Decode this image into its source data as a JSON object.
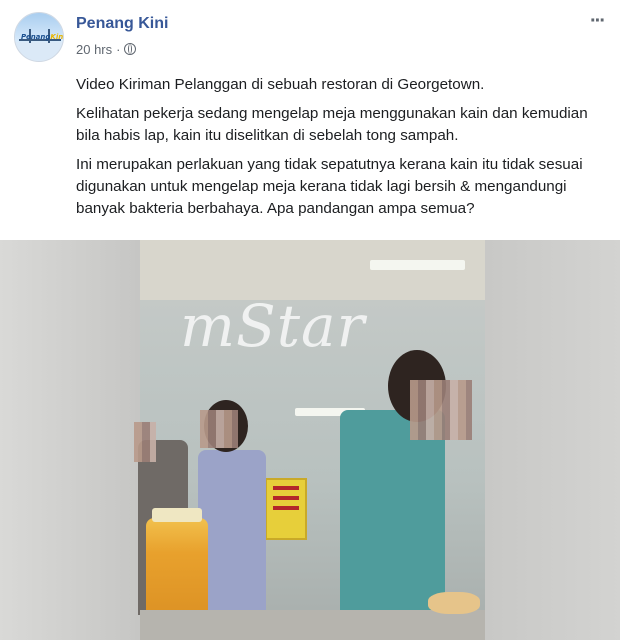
{
  "post": {
    "page_name": "Penang Kini",
    "avatar_logo_a": "Penang",
    "avatar_logo_b": "Kini",
    "time": "20 hrs",
    "dot": "·",
    "more": "···",
    "paragraphs": [
      "Video Kiriman Pelanggan di sebuah restoran di Georgetown.",
      "Kelihatan pekerja sedang mengelap meja menggunakan kain dan kemudian bila habis lap, kain itu diselitkan di sebelah tong sampah.",
      "Ini merupakan perlakuan yang tidak sepatutnya kerana kain itu tidak sesuai digunakan untuk mengelap meja kerana tidak lagi bersih & mengandungi banyak bakteria berbahaya. Apa pandangan ampa semua?"
    ],
    "watermark": "mStar"
  },
  "colors": {
    "page_name": "#385898",
    "meta": "#606770",
    "text": "#1c1e21"
  }
}
